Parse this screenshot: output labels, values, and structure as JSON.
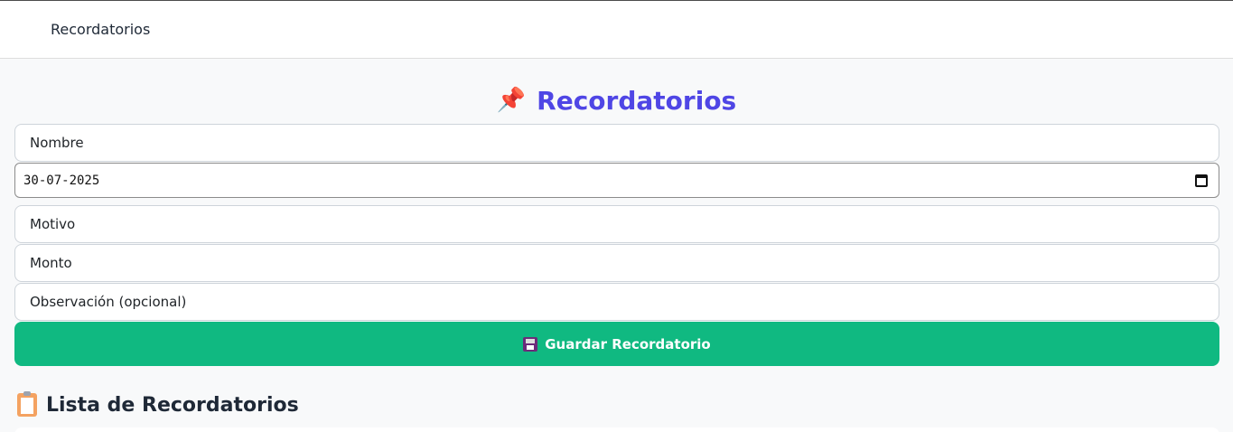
{
  "navbar": {
    "brand": "Recordatorios"
  },
  "header": {
    "emoji": "📌",
    "title": "Recordatorios"
  },
  "form": {
    "nombre_placeholder": "Nombre",
    "fecha_value": "30-07-2025",
    "motivo_placeholder": "Motivo",
    "monto_placeholder": "Monto",
    "observacion_placeholder": "Observación (opcional)",
    "save_label": "Guardar Recordatorio"
  },
  "list": {
    "title": "Lista de Recordatorios"
  },
  "colors": {
    "accent": "#4f46e5",
    "button": "#10b981",
    "background": "#f8f9fa"
  }
}
